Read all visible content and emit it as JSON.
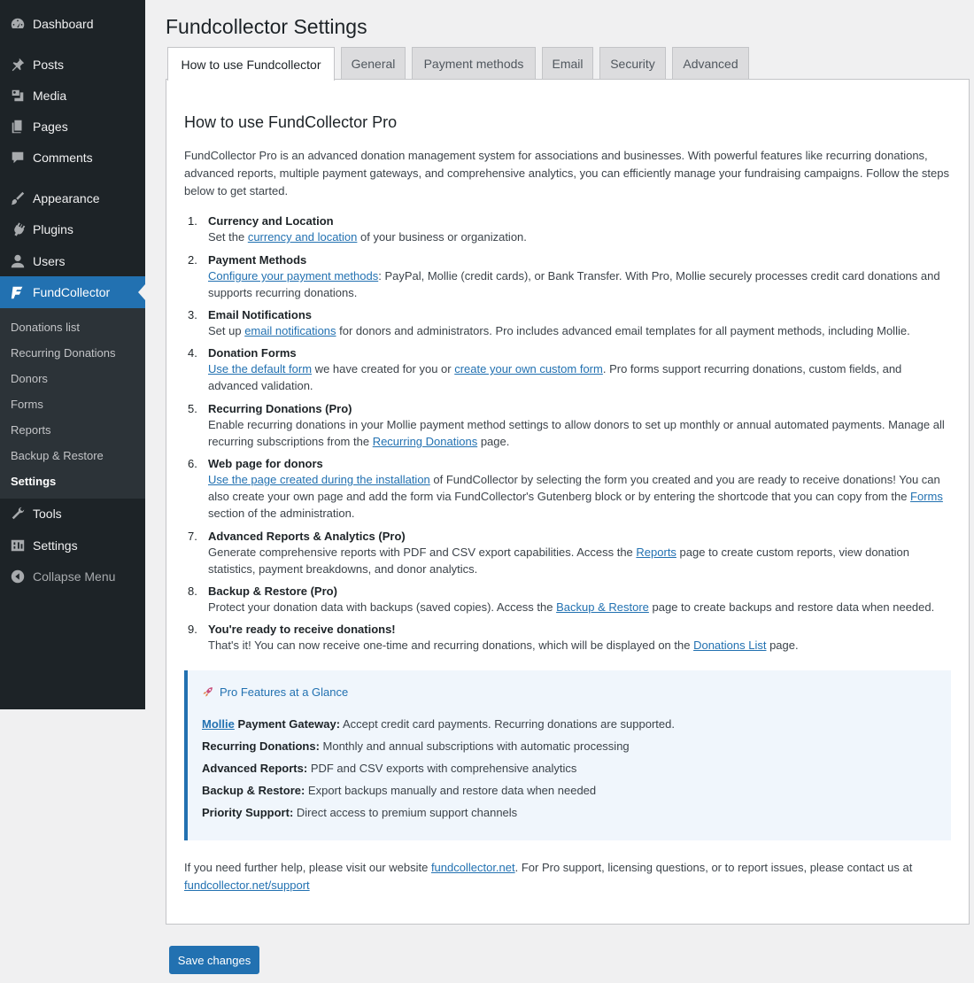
{
  "sidebar": {
    "items": [
      {
        "label": "Dashboard",
        "icon": "dashboard-icon"
      },
      {
        "label": "Posts",
        "icon": "pin-icon"
      },
      {
        "label": "Media",
        "icon": "media-icon"
      },
      {
        "label": "Pages",
        "icon": "pages-icon"
      },
      {
        "label": "Comments",
        "icon": "comment-icon"
      },
      {
        "label": "Appearance",
        "icon": "brush-icon"
      },
      {
        "label": "Plugins",
        "icon": "plugin-icon"
      },
      {
        "label": "Users",
        "icon": "user-icon"
      },
      {
        "label": "FundCollector",
        "icon": "fundcollector-icon"
      },
      {
        "label": "Tools",
        "icon": "wrench-icon"
      },
      {
        "label": "Settings",
        "icon": "settings-icon"
      },
      {
        "label": "Collapse Menu",
        "icon": "collapse-icon"
      }
    ],
    "submenu": [
      "Donations list",
      "Recurring Donations",
      "Donors",
      "Forms",
      "Reports",
      "Backup & Restore",
      "Settings"
    ]
  },
  "page": {
    "title": "Fundcollector Settings"
  },
  "tabs": [
    "How to use Fundcollector",
    "General",
    "Payment methods",
    "Email",
    "Security",
    "Advanced"
  ],
  "content": {
    "title": "How to use FundCollector Pro",
    "intro": "FundCollector Pro is an advanced donation management system for associations and businesses. With powerful features like recurring donations, advanced reports, multiple payment gateways, and comprehensive analytics, you can efficiently manage your fundraising campaigns. Follow the steps below to get started.",
    "steps": [
      {
        "num": "1.",
        "title": "Currency and Location",
        "d1": "Set the ",
        "l1": "currency and location",
        "d2": " of your business or organization."
      },
      {
        "num": "2.",
        "title": "Payment Methods",
        "l1": "Configure your payment methods",
        "d1": ": PayPal, Mollie (credit cards), or Bank Transfer. With Pro, Mollie securely processes credit card donations and supports recurring donations."
      },
      {
        "num": "3.",
        "title": "Email Notifications",
        "d1": "Set up ",
        "l1": "email notifications",
        "d2": " for donors and administrators. Pro includes advanced email templates for all payment methods, including Mollie."
      },
      {
        "num": "4.",
        "title": "Donation Forms",
        "l1": "Use the default form",
        "d1": " we have created for you or ",
        "l2": "create your own custom form",
        "d2": ". Pro forms support recurring donations, custom fields, and advanced validation."
      },
      {
        "num": "5.",
        "title": "Recurring Donations (Pro)",
        "d1": "Enable recurring donations in your Mollie payment method settings to allow donors to set up monthly or annual automated payments. Manage all recurring subscriptions from the ",
        "l1": "Recurring Donations",
        "d2": " page."
      },
      {
        "num": "6.",
        "title": "Web page for donors",
        "l1": "Use the page created during the installation",
        "d1": " of FundCollector by selecting the form you created and you are ready to receive donations! You can also create your own page and add the form via FundCollector's Gutenberg block or by entering the shortcode that you can copy from the ",
        "l2": "Forms",
        "d2": " section of the administration."
      },
      {
        "num": "7.",
        "title": "Advanced Reports & Analytics (Pro)",
        "d1": "Generate comprehensive reports with PDF and CSV export capabilities. Access the ",
        "l1": "Reports",
        "d2": " page to create custom reports, view donation statistics, payment breakdowns, and donor analytics."
      },
      {
        "num": "8.",
        "title": "Backup & Restore (Pro)",
        "d1": "Protect your donation data with backups (saved copies). Access the ",
        "l1": "Backup & Restore",
        "d2": " page to create backups and restore data when needed."
      },
      {
        "num": "9.",
        "title": "You're ready to receive donations!",
        "d1": "That's it! You can now receive one-time and recurring donations, which will be displayed on the ",
        "l1": "Donations List",
        "d2": " page."
      }
    ],
    "pro_box": {
      "title": "Pro Features at a Glance",
      "icon": "rocket-icon",
      "lines": [
        {
          "link": "Mollie",
          "bold": " Payment Gateway:",
          "text": " Accept credit card payments. Recurring donations are supported."
        },
        {
          "link": "",
          "bold": "Recurring Donations:",
          "text": " Monthly and annual subscriptions with automatic processing"
        },
        {
          "link": "",
          "bold": "Advanced Reports:",
          "text": " PDF and CSV exports with comprehensive analytics"
        },
        {
          "link": "",
          "bold": "Backup & Restore:",
          "text": " Export backups manually and restore data when needed"
        },
        {
          "link": "",
          "bold": "Priority Support:",
          "text": " Direct access to premium support channels"
        }
      ]
    },
    "footer": {
      "t1": "If you need further help, please visit our website ",
      "l1": "fundcollector.net",
      "t2": ". For Pro support, licensing questions, or to report issues, please contact us at ",
      "l2": "fundcollector.net/support"
    }
  },
  "save_label": "Save changes"
}
